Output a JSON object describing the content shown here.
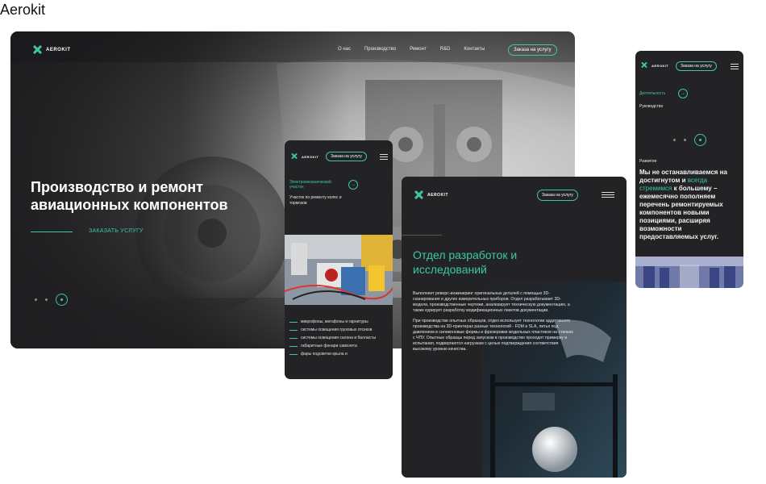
{
  "page_caption": "Aerokit",
  "brand": {
    "name": "AEROKIT",
    "accent_color": "#3ec7a5",
    "dark_bg": "#232326"
  },
  "desktop": {
    "nav": [
      "О нас",
      "Производство",
      "Ремонт",
      "R&D",
      "Контакты"
    ],
    "order_button": "Заказа на услугу",
    "hero_title": "Производство и ремонт авиационных компонентов",
    "hero_cta": "ЗАКАЗАТЬ УСЛУГУ"
  },
  "mobile_repair": {
    "order_button": "Заказа на услугу",
    "accent_title": "Электромеханический участок",
    "subtitle": "Участок по ремонту колес и тормозов",
    "list": [
      "микрофоны, мегафоны и гарнитуры",
      "системы освещения грузовых отсеков",
      "системы освещения салона и балласты",
      "габаритные фонари самолета",
      "фары подсветки крыла и"
    ]
  },
  "tablet_rnd": {
    "order_button": "Заказа на услугу",
    "title": "Отдел разработок и исследований",
    "paragraph_1": "Выполняет реверс-инжиниринг оригинальных деталей с помощью 3D-сканирования и других измерительных приборов. Отдел разрабатывает 3D-модели, производственные чертежи, анализирует техническую документацию, а также курирует разработку модификационных пакетов документации.",
    "paragraph_2": "При производстве опытных образцов, отдел использует технологии аддитивного производства на 3D-принтерах разных технологий - FDM и SLA, литья под давлением в силиконовые формы и фрезеровки модельных пластиков на станках с ЧПУ. Опытные образцы перед запуском в производство проходят примерку и испытания, подвергаются нагрузкам с целью подтверждения соответствия высокому уровню качества."
  },
  "mobile_activity": {
    "order_button": "Заказа на услугу",
    "accent_title": "Деятельность",
    "subtitle": "Руководство",
    "tag": "Развитие",
    "text_before": "Мы не останавливаемся на достигнутом и ",
    "text_highlight": "всегда стремимся",
    "text_after": " к большему – ежемесячно пополняем перечень ремонтируемых компонентов новыми позициями, расширяя возможности предоставляемых услуг."
  },
  "icons": {
    "logo": "aerokit-logo-icon",
    "menu": "burger-menu-icon",
    "arrow": "arrow-right-icon"
  }
}
